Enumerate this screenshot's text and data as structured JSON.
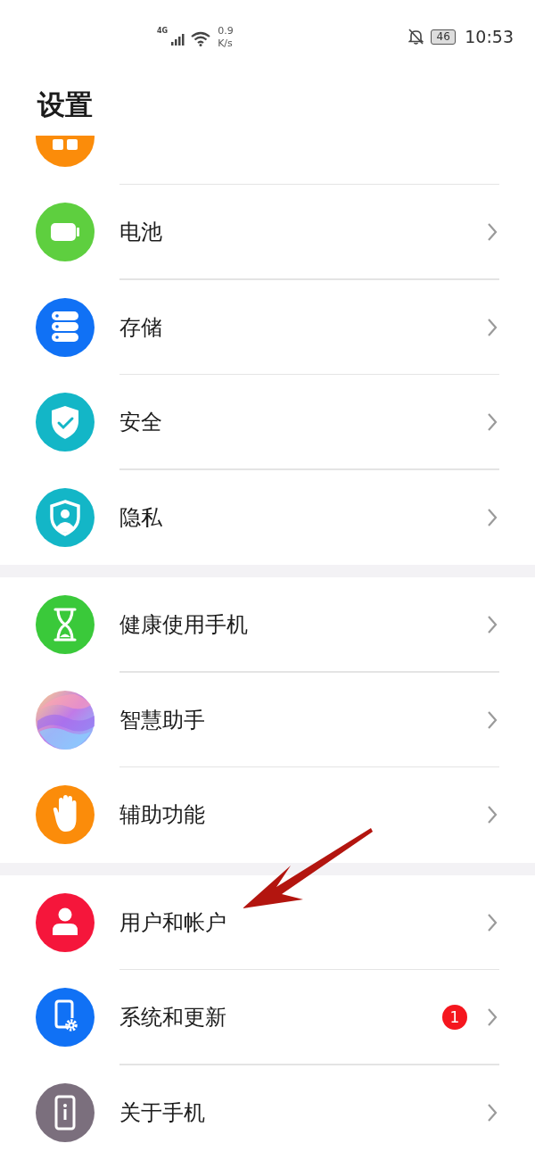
{
  "status_bar": {
    "network": "4G",
    "speed_value": "0.9",
    "speed_unit": "K/s",
    "battery": "46",
    "time": "10:53"
  },
  "title": "设置",
  "cut_item": {
    "kind": "apps",
    "color": "#fb8c0a"
  },
  "groups": [
    {
      "items": [
        {
          "label": "电池",
          "kind": "battery",
          "color": "#5ecf3f"
        },
        {
          "label": "存储",
          "kind": "storage",
          "color": "#1071f5"
        },
        {
          "label": "安全",
          "kind": "shield-check",
          "color": "#13b6c7"
        },
        {
          "label": "隐私",
          "kind": "shield-person",
          "color": "#13b6c7"
        }
      ]
    },
    {
      "items": [
        {
          "label": "健康使用手机",
          "kind": "hourglass",
          "color": "#3ac93a"
        },
        {
          "label": "智慧助手",
          "kind": "orb",
          "color": "#c07ae8"
        },
        {
          "label": "辅助功能",
          "kind": "hand",
          "color": "#fb8c0a"
        }
      ]
    },
    {
      "items": [
        {
          "label": "用户和帐户",
          "kind": "user",
          "color": "#f5163b"
        },
        {
          "label": "系统和更新",
          "kind": "phone-gear",
          "color": "#1071f5",
          "badge": "1"
        },
        {
          "label": "关于手机",
          "kind": "phone-info",
          "color": "#7b6f7d"
        }
      ]
    }
  ]
}
